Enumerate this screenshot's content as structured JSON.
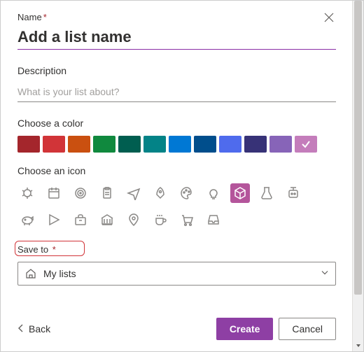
{
  "name": {
    "label": "Name",
    "required_mark": "*",
    "placeholder": "Add a list name",
    "value": ""
  },
  "description": {
    "label": "Description",
    "placeholder": "What is your list about?",
    "value": ""
  },
  "color": {
    "label": "Choose a color",
    "options": [
      {
        "name": "dark-red",
        "hex": "#a4262c"
      },
      {
        "name": "red",
        "hex": "#d13438"
      },
      {
        "name": "orange",
        "hex": "#ca5010"
      },
      {
        "name": "green",
        "hex": "#10893e"
      },
      {
        "name": "dark-green",
        "hex": "#005e50"
      },
      {
        "name": "teal",
        "hex": "#038387"
      },
      {
        "name": "blue",
        "hex": "#0078d4"
      },
      {
        "name": "navy",
        "hex": "#004e8c"
      },
      {
        "name": "indigo",
        "hex": "#4f6bed"
      },
      {
        "name": "dark-purple",
        "hex": "#373277"
      },
      {
        "name": "purple",
        "hex": "#8764b8"
      },
      {
        "name": "pink",
        "hex": "#c47dbb",
        "selected": true
      }
    ]
  },
  "icon": {
    "label": "Choose an icon",
    "options": [
      "bug-icon",
      "calendar-icon",
      "target-icon",
      "clipboard-icon",
      "airplane-icon",
      "rocket-icon",
      "palette-icon",
      "lightbulb-icon",
      "cube-icon",
      "beaker-icon",
      "robot-icon",
      "piggy-bank-icon",
      "play-icon",
      "briefcase-icon",
      "bank-icon",
      "location-icon",
      "coffee-icon",
      "cart-icon",
      "inbox-icon"
    ],
    "selected": "cube-icon"
  },
  "save_to": {
    "label": "Save to",
    "required_mark": "*",
    "selected": "My lists"
  },
  "footer": {
    "back": "Back",
    "create": "Create",
    "cancel": "Cancel"
  }
}
